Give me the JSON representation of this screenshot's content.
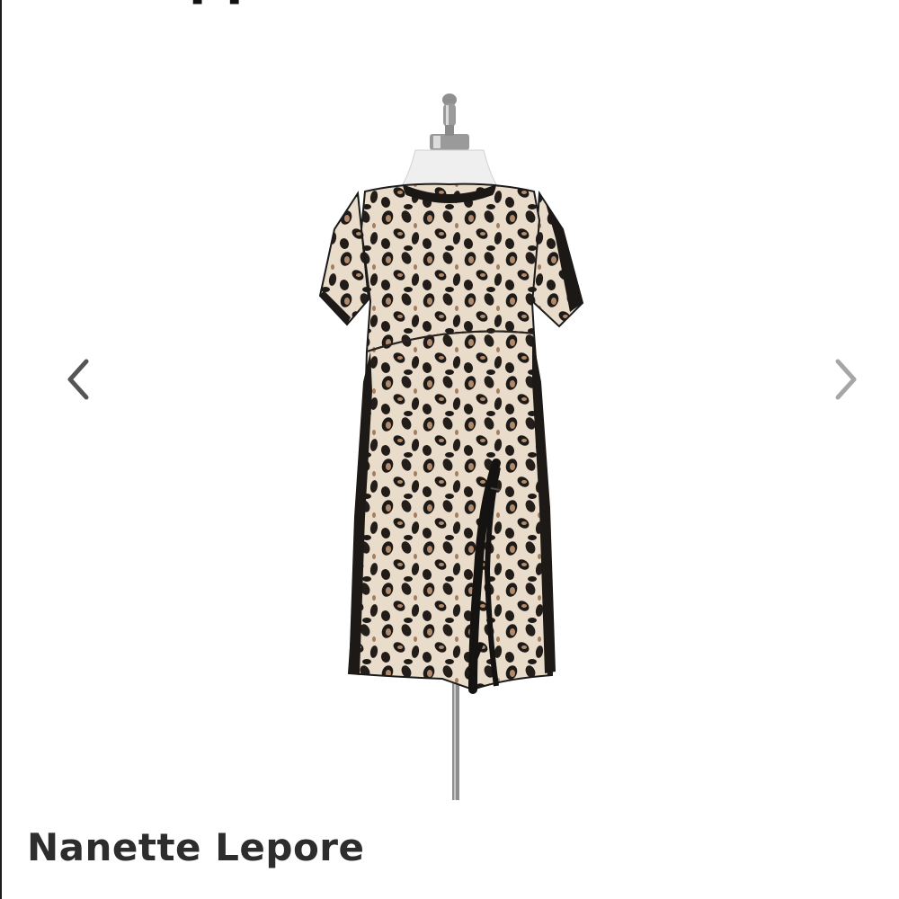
{
  "header": {
    "title_fragment": "pp"
  },
  "gallery": {
    "prev_icon": "chevron-left-icon",
    "next_icon": "chevron-right-icon",
    "prev_color": "#555555",
    "next_color": "#a6a6a6",
    "image_subject": "dress-on-mannequin"
  },
  "product": {
    "brand": "Nanette Lepore"
  },
  "colors": {
    "background": "#ffffff",
    "brand_text": "#2d2d2d"
  }
}
